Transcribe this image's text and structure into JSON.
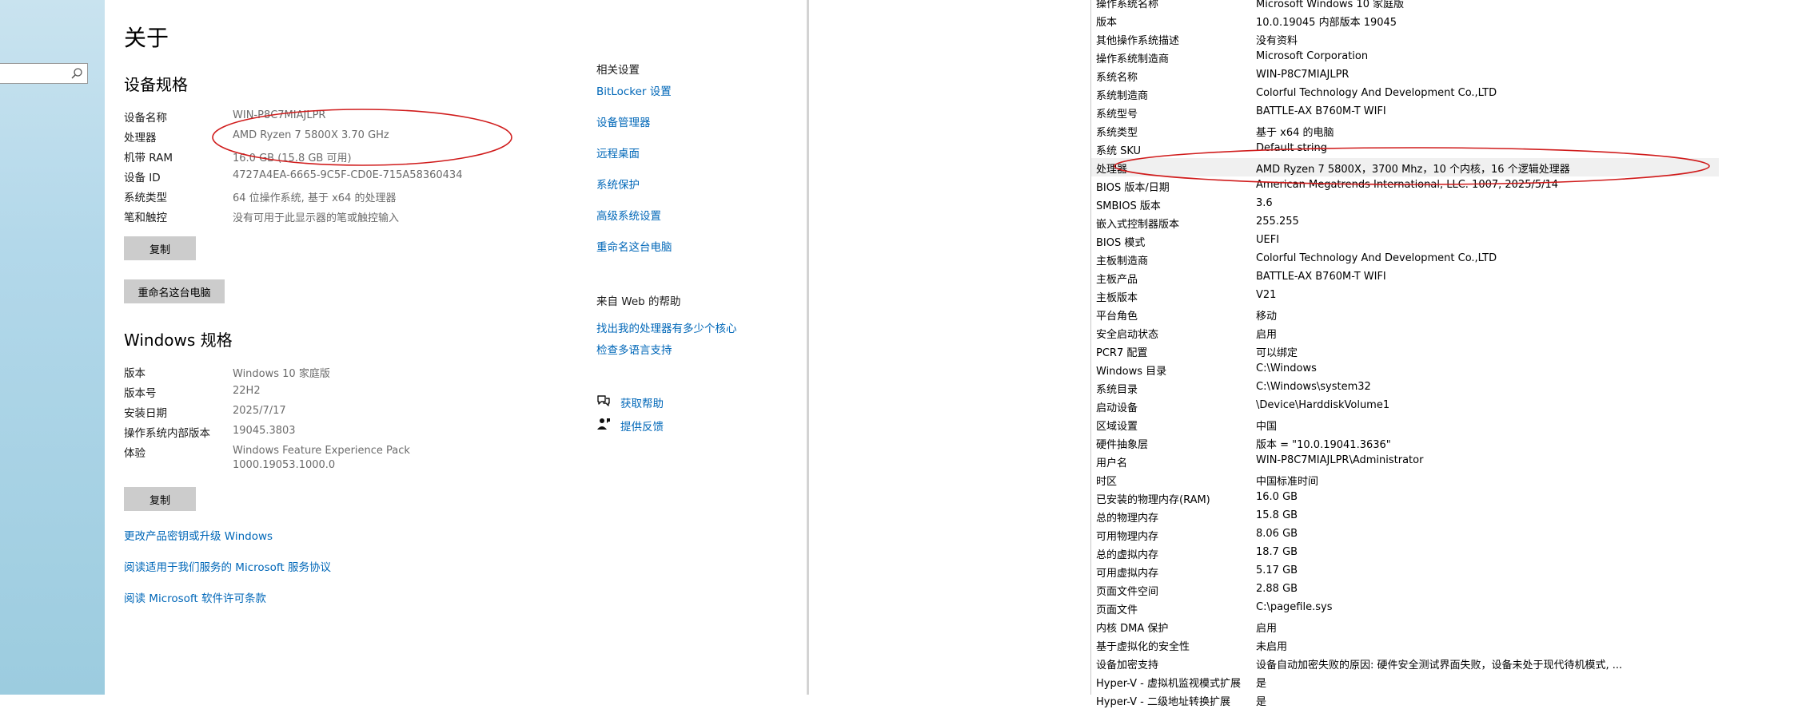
{
  "about": {
    "title": "关于",
    "device_specs": {
      "heading": "设备规格",
      "rows": [
        {
          "label": "设备名称",
          "value": "WIN-P8C7MIAJLPR"
        },
        {
          "label": "处理器",
          "value": "AMD Ryzen 7 5800X   3.70 GHz"
        },
        {
          "label": "机带 RAM",
          "value": "16.0 GB (15.8 GB 可用)"
        },
        {
          "label": "设备 ID",
          "value": "4727A4EA-6665-9C5F-CD0E-715A58360434"
        },
        {
          "label": "系统类型",
          "value": "64 位操作系统, 基于 x64 的处理器"
        },
        {
          "label": "笔和触控",
          "value": "没有可用于此显示器的笔或触控输入"
        }
      ],
      "copy_button": "复制",
      "rename_button": "重命名这台电脑"
    },
    "windows_specs": {
      "heading": "Windows 规格",
      "rows": [
        {
          "label": "版本",
          "value": "Windows 10 家庭版"
        },
        {
          "label": "版本号",
          "value": "22H2"
        },
        {
          "label": "安装日期",
          "value": "2025/7/17"
        },
        {
          "label": "操作系统内部版本",
          "value": "19045.3803"
        },
        {
          "label": "体验",
          "value": "Windows Feature Experience Pack",
          "value2": "1000.19053.1000.0"
        }
      ],
      "copy_button": "复制"
    },
    "bottom_links": [
      "更改产品密钥或升级 Windows",
      "阅读适用于我们服务的 Microsoft 服务协议",
      "阅读 Microsoft 软件许可条款"
    ],
    "related": {
      "heading": "相关设置",
      "links": [
        "BitLocker 设置",
        "设备管理器",
        "远程桌面",
        "系统保护",
        "高级系统设置",
        "重命名这台电脑"
      ]
    },
    "web_help": {
      "heading": "来自 Web 的帮助",
      "links": [
        "找出我的处理器有多少个核心",
        "检查多语言支持"
      ]
    },
    "help": {
      "get_help": "获取帮助",
      "feedback": "提供反馈"
    }
  },
  "sysinfo": {
    "rows": [
      {
        "item": "操作系统名称",
        "value": "Microsoft Windows 10 家庭版"
      },
      {
        "item": "版本",
        "value": "10.0.19045 内部版本 19045"
      },
      {
        "item": "其他操作系统描述",
        "value": "没有资料"
      },
      {
        "item": "操作系统制造商",
        "value": "Microsoft Corporation"
      },
      {
        "item": "系统名称",
        "value": "WIN-P8C7MIAJLPR"
      },
      {
        "item": "系统制造商",
        "value": "Colorful Technology And Development Co.,LTD"
      },
      {
        "item": "系统型号",
        "value": "BATTLE-AX B760M-T WIFI"
      },
      {
        "item": "系统类型",
        "value": "基于 x64 的电脑"
      },
      {
        "item": "系统 SKU",
        "value": "Default string"
      },
      {
        "item": "处理器",
        "value": "AMD Ryzen 7 5800X，3700 Mhz，10 个内核，16 个逻辑处理器"
      },
      {
        "item": "BIOS 版本/日期",
        "value": "American Megatrends International, LLC. 1007, 2025/5/14"
      },
      {
        "item": "SMBIOS 版本",
        "value": "3.6"
      },
      {
        "item": "嵌入式控制器版本",
        "value": "255.255"
      },
      {
        "item": "BIOS 模式",
        "value": "UEFI"
      },
      {
        "item": "主板制造商",
        "value": "Colorful Technology And Development Co.,LTD"
      },
      {
        "item": "主板产品",
        "value": "BATTLE-AX B760M-T WIFI"
      },
      {
        "item": "主板版本",
        "value": "V21"
      },
      {
        "item": "平台角色",
        "value": "移动"
      },
      {
        "item": "安全启动状态",
        "value": "启用"
      },
      {
        "item": "PCR7 配置",
        "value": "可以绑定"
      },
      {
        "item": "Windows 目录",
        "value": "C:\\Windows"
      },
      {
        "item": "系统目录",
        "value": "C:\\Windows\\system32"
      },
      {
        "item": "启动设备",
        "value": "\\Device\\HarddiskVolume1"
      },
      {
        "item": "区域设置",
        "value": "中国"
      },
      {
        "item": "硬件抽象层",
        "value": "版本 = \"10.0.19041.3636\""
      },
      {
        "item": "用户名",
        "value": "WIN-P8C7MIAJLPR\\Administrator"
      },
      {
        "item": "时区",
        "value": "中国标准时间"
      },
      {
        "item": "已安装的物理内存(RAM)",
        "value": "16.0 GB"
      },
      {
        "item": "总的物理内存",
        "value": "15.8 GB"
      },
      {
        "item": "可用物理内存",
        "value": "8.06 GB"
      },
      {
        "item": "总的虚拟内存",
        "value": "18.7 GB"
      },
      {
        "item": "可用虚拟内存",
        "value": "5.17 GB"
      },
      {
        "item": "页面文件空间",
        "value": "2.88 GB"
      },
      {
        "item": "页面文件",
        "value": "C:\\pagefile.sys"
      },
      {
        "item": "内核 DMA 保护",
        "value": "启用"
      },
      {
        "item": "基于虚拟化的安全性",
        "value": "未启用"
      },
      {
        "item": "设备加密支持",
        "value": "设备自动加密失败的原因: 硬件安全测试界面失败，设备未处于现代待机模式, ..."
      },
      {
        "item": "Hyper-V - 虚拟机监视模式扩展",
        "value": "是"
      },
      {
        "item": "Hyper-V - 二级地址转换扩展",
        "value": "是"
      }
    ]
  },
  "colors": {
    "link": "#0067b8",
    "annotation_ellipse": "#d01c1c",
    "button": "#cccccc",
    "sidebar": "#b3d8ea"
  }
}
